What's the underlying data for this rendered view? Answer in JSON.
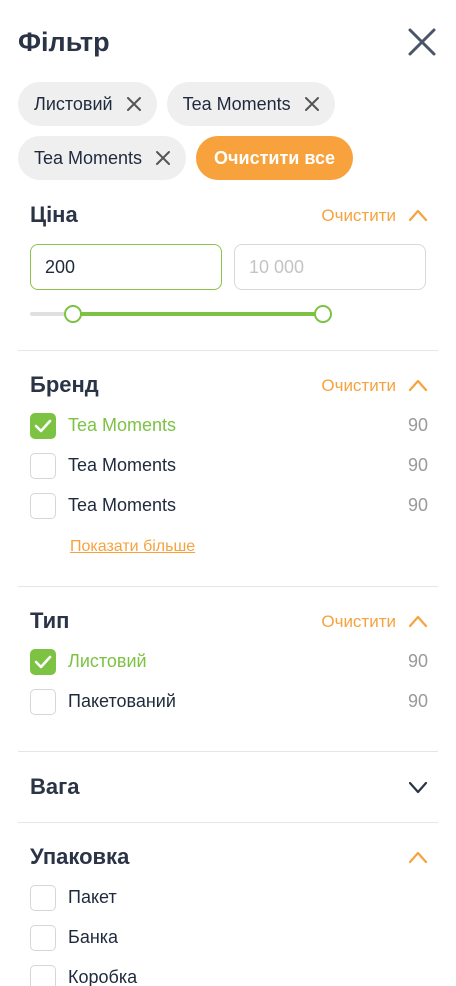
{
  "header": {
    "title": "Фільтр"
  },
  "chips": {
    "row1": [
      {
        "label": "Листовий"
      },
      {
        "label": "Tea Moments"
      }
    ],
    "row2": [
      {
        "label": "Tea Moments"
      }
    ],
    "clear_all": "Очистити все"
  },
  "price": {
    "title": "Ціна",
    "clear": "Очистити",
    "min_value": "200",
    "max_placeholder": "10 000",
    "range_selected": [
      0.12,
      1.0
    ]
  },
  "brand": {
    "title": "Бренд",
    "clear": "Очистити",
    "items": [
      {
        "label": "Tea Moments",
        "count": "90",
        "checked": true
      },
      {
        "label": "Tea Moments",
        "count": "90",
        "checked": false
      },
      {
        "label": "Tea Moments",
        "count": "90",
        "checked": false
      }
    ],
    "show_more": "Показати більше"
  },
  "type": {
    "title": "Тип",
    "clear": "Очистити",
    "items": [
      {
        "label": "Листовий",
        "count": "90",
        "checked": true
      },
      {
        "label": "Пакетований",
        "count": "90",
        "checked": false
      }
    ]
  },
  "weight": {
    "title": "Вага"
  },
  "packaging": {
    "title": "Упаковка",
    "items": [
      {
        "label": "Пакет",
        "checked": false
      },
      {
        "label": "Банка",
        "checked": false
      },
      {
        "label": "Коробка",
        "checked": false
      }
    ]
  },
  "colors": {
    "accent": "#f7a23c",
    "green": "#7cc243",
    "chip_bg": "#efefef"
  }
}
